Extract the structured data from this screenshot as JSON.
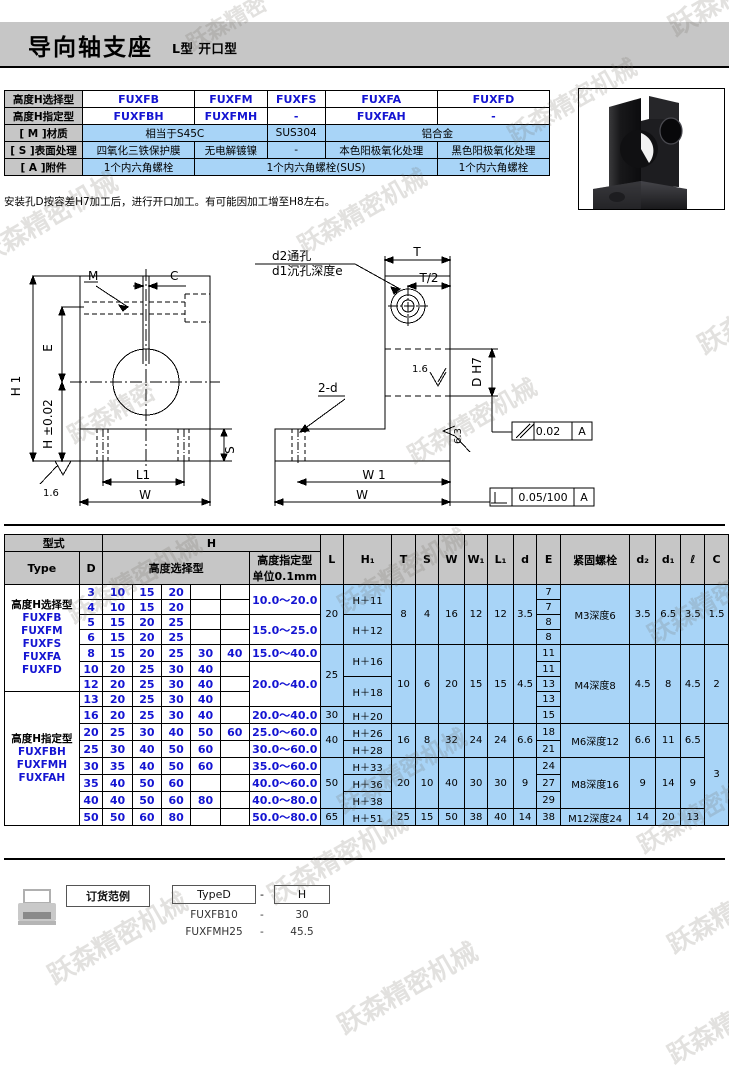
{
  "header": {
    "title": "导向轴支座",
    "subtitle": "L型  开口型"
  },
  "spec_table": {
    "rows": [
      {
        "label": "高度H选择型",
        "type": "code",
        "cells": [
          "FUXFB",
          "FUXFM",
          "FUXFS",
          "FUXFA",
          "FUXFD"
        ]
      },
      {
        "label": "高度H指定型",
        "type": "code",
        "cells": [
          "FUXFBH",
          "FUXFMH",
          "-",
          "FUXFAH",
          "-"
        ]
      },
      {
        "label": "[ M ]材质",
        "type": "blue",
        "cells": [
          "相当于S45C",
          "SUS304",
          "铝合金"
        ],
        "spans": [
          2,
          1,
          2
        ]
      },
      {
        "label": "[ S ]表面处理",
        "type": "blue",
        "cells": [
          "四氧化三铁保护膜",
          "无电解镀镍",
          "-",
          "本色阳极氧化处理",
          "黑色阳极氧化处理"
        ],
        "spans": [
          1,
          1,
          1,
          1,
          1
        ]
      },
      {
        "label": "[ A ]附件",
        "type": "blue",
        "cells": [
          "1个内六角螺栓",
          "1个内六角螺栓(SUS)",
          "1个内六角螺栓"
        ],
        "spans": [
          1,
          3,
          1
        ]
      }
    ]
  },
  "note": "安装孔D按容差H7加工后，进行开口加工。有可能因加工增至H8左右。",
  "drawing": {
    "front_view_labels": {
      "h1": "H 1",
      "h_tol": "H ±0.02",
      "e": "E",
      "m": "M",
      "c": "C",
      "l1": "L1",
      "w": "W",
      "s": "S",
      "roughness": "1.6"
    },
    "side_view_labels": {
      "counterbore": "d2通孔",
      "counterbore2": "d1沉孔深度e",
      "two_d": "2-d",
      "t": "T",
      "t_half": "T/2",
      "dh7": "D H7",
      "w1": "W 1",
      "w": "W",
      "roughness_16": "1.6",
      "roughness_63": "6.3"
    },
    "gd_t": {
      "parallel_symbol": "//",
      "parallel_value": "0.02",
      "parallel_datum": "A",
      "perp_symbol": "⊥",
      "perp_value": "0.05/100",
      "perp_datum": "A"
    }
  },
  "main_table": {
    "group_headers": {
      "type": "型式",
      "h": "H"
    },
    "headers": {
      "type": "Type",
      "d": "D",
      "h_select": "高度选择型",
      "h_assign_l1": "高度指定型",
      "h_assign_l2": "单位0.1mm",
      "l": "L",
      "h1": "H₁",
      "t": "T",
      "s": "S",
      "w": "W",
      "w1": "W₁",
      "l1": "L₁",
      "d_small": "d",
      "e": "E",
      "bolt": "紧固螺栓",
      "d2": "d₂",
      "d1": "d₁",
      "ell": "ℓ",
      "c": "C"
    },
    "type_groups": [
      {
        "title": "高度H选择型",
        "codes": [
          "FUXFB",
          "FUXFM",
          "FUXFS",
          "FUXFA",
          "FUXFD"
        ],
        "rowspan": 7
      },
      {
        "title": "高度H指定型",
        "codes": [
          "FUXFBH",
          "FUXFMH",
          "FUXFAH"
        ],
        "rowspan": 8
      }
    ],
    "rows": [
      {
        "d": "3",
        "h_options": [
          "10",
          "15",
          "20"
        ]
      },
      {
        "d": "4",
        "h_options": [
          "10",
          "15",
          "20"
        ]
      },
      {
        "d": "5",
        "h_options": [
          "15",
          "20",
          "25"
        ]
      },
      {
        "d": "6",
        "h_options": [
          "15",
          "20",
          "25"
        ]
      },
      {
        "d": "8",
        "h_options": [
          "15",
          "20",
          "25",
          "30",
          "40"
        ]
      },
      {
        "d": "10",
        "h_options": [
          "20",
          "25",
          "30",
          "40"
        ]
      },
      {
        "d": "12",
        "h_options": [
          "20",
          "25",
          "30",
          "40"
        ]
      },
      {
        "d": "13",
        "h_options": [
          "20",
          "25",
          "30",
          "40"
        ]
      },
      {
        "d": "16",
        "h_options": [
          "20",
          "25",
          "30",
          "40"
        ]
      },
      {
        "d": "20",
        "h_options": [
          "25",
          "30",
          "40",
          "50",
          "60"
        ]
      },
      {
        "d": "25",
        "h_options": [
          "30",
          "40",
          "50",
          "60"
        ]
      },
      {
        "d": "30",
        "h_options": [
          "35",
          "40",
          "50",
          "60"
        ]
      },
      {
        "d": "35",
        "h_options": [
          "40",
          "50",
          "60"
        ]
      },
      {
        "d": "40",
        "h_options": [
          "40",
          "50",
          "60",
          "80"
        ]
      },
      {
        "d": "50",
        "h_options": [
          "50",
          "60",
          "80"
        ]
      }
    ],
    "h_assign": [
      {
        "value": "10.0〜20.0",
        "rows": 2
      },
      {
        "value": "15.0〜25.0",
        "rows": 2
      },
      {
        "value": "15.0〜40.0",
        "rows": 1
      },
      {
        "value": "20.0〜40.0",
        "rows": 3
      },
      {
        "value": "20.0〜40.0",
        "rows": 1
      },
      {
        "value": "25.0〜60.0",
        "rows": 1
      },
      {
        "value": "30.0〜60.0",
        "rows": 1
      },
      {
        "value": "35.0〜60.0",
        "rows": 1
      },
      {
        "value": "40.0〜60.0",
        "rows": 1
      },
      {
        "value": "40.0〜80.0",
        "rows": 1
      },
      {
        "value": "50.0〜80.0",
        "rows": 1
      }
    ],
    "l_values": [
      {
        "value": "20",
        "rows": 4
      },
      {
        "value": "25",
        "rows": 4
      },
      {
        "value": "30",
        "rows": 1
      },
      {
        "value": "40",
        "rows": 2
      },
      {
        "value": "50",
        "rows": 3
      },
      {
        "value": "65",
        "rows": 1
      }
    ],
    "h1_values": [
      {
        "value": "H＋11",
        "rows": 2
      },
      {
        "value": "H＋12",
        "rows": 2
      },
      {
        "value": "H＋16",
        "rows": 2
      },
      {
        "value": "H＋18",
        "rows": 2
      },
      {
        "value": "H＋20",
        "rows": 1
      },
      {
        "value": "H＋26",
        "rows": 1
      },
      {
        "value": "H＋28",
        "rows": 1
      },
      {
        "value": "H＋33",
        "rows": 1
      },
      {
        "value": "H＋36",
        "rows": 1
      },
      {
        "value": "H＋38",
        "rows": 1
      },
      {
        "value": "H＋51",
        "rows": 1
      }
    ],
    "t_values": [
      {
        "value": "8",
        "rows": 4
      },
      {
        "value": "10",
        "rows": 5
      },
      {
        "value": "16",
        "rows": 2
      },
      {
        "value": "20",
        "rows": 3
      },
      {
        "value": "25",
        "rows": 1
      }
    ],
    "s_values": [
      {
        "value": "4",
        "rows": 4
      },
      {
        "value": "6",
        "rows": 5
      },
      {
        "value": "8",
        "rows": 2
      },
      {
        "value": "10",
        "rows": 3
      },
      {
        "value": "15",
        "rows": 1
      }
    ],
    "w_values": [
      {
        "value": "16",
        "rows": 4
      },
      {
        "value": "20",
        "rows": 5
      },
      {
        "value": "32",
        "rows": 2
      },
      {
        "value": "40",
        "rows": 3
      },
      {
        "value": "50",
        "rows": 1
      }
    ],
    "w1_values": [
      {
        "value": "12",
        "rows": 4
      },
      {
        "value": "15",
        "rows": 5
      },
      {
        "value": "24",
        "rows": 2
      },
      {
        "value": "30",
        "rows": 3
      },
      {
        "value": "38",
        "rows": 1
      }
    ],
    "l1_values": [
      {
        "value": "12",
        "rows": 4
      },
      {
        "value": "15",
        "rows": 5
      },
      {
        "value": "24",
        "rows": 2
      },
      {
        "value": "30",
        "rows": 3
      },
      {
        "value": "40",
        "rows": 1
      }
    ],
    "d_values": [
      {
        "value": "3.5",
        "rows": 4
      },
      {
        "value": "4.5",
        "rows": 5
      },
      {
        "value": "6.6",
        "rows": 2
      },
      {
        "value": "9",
        "rows": 3
      },
      {
        "value": "14",
        "rows": 1
      }
    ],
    "e_values": [
      "7",
      "7",
      "8",
      "8",
      "11",
      "11",
      "13",
      "13",
      "15",
      "18",
      "21",
      "24",
      "27",
      "29",
      "38"
    ],
    "bolt_values": [
      {
        "value": "M3深度6",
        "rows": 4
      },
      {
        "value": "M4深度8",
        "rows": 5
      },
      {
        "value": "M6深度12",
        "rows": 2
      },
      {
        "value": "M8深度16",
        "rows": 3
      },
      {
        "value": "M12深度24",
        "rows": 1
      }
    ],
    "d2_values": [
      {
        "value": "3.5",
        "rows": 4
      },
      {
        "value": "4.5",
        "rows": 5
      },
      {
        "value": "6.6",
        "rows": 2
      },
      {
        "value": "9",
        "rows": 3
      },
      {
        "value": "14",
        "rows": 1
      }
    ],
    "d1_values": [
      {
        "value": "6.5",
        "rows": 4
      },
      {
        "value": "8",
        "rows": 5
      },
      {
        "value": "11",
        "rows": 2
      },
      {
        "value": "14",
        "rows": 3
      },
      {
        "value": "20",
        "rows": 1
      }
    ],
    "ell_values": [
      {
        "value": "3.5",
        "rows": 4
      },
      {
        "value": "4.5",
        "rows": 5
      },
      {
        "value": "6.5",
        "rows": 2
      },
      {
        "value": "9",
        "rows": 3
      },
      {
        "value": "13",
        "rows": 1
      }
    ],
    "c_values": [
      {
        "value": "1.5",
        "rows": 4
      },
      {
        "value": "2",
        "rows": 5
      },
      {
        "value": "3",
        "rows": 6
      }
    ]
  },
  "order_example": {
    "label": "订货范例",
    "col1": "TypeD",
    "dash": "-",
    "col2": "H",
    "examples": [
      {
        "type": "FUXFB10",
        "dash": "-",
        "h": "30"
      },
      {
        "type": "FUXFMH25",
        "dash": "-",
        "h": "45.5"
      }
    ]
  },
  "watermark": {
    "text": "跃森精密机械",
    "short": "跃森精密"
  },
  "colors": {
    "header_bg": "#c6c6c6",
    "code_blue": "#1414d2",
    "cell_blue": "#a8d4f7",
    "line": "#000000"
  }
}
